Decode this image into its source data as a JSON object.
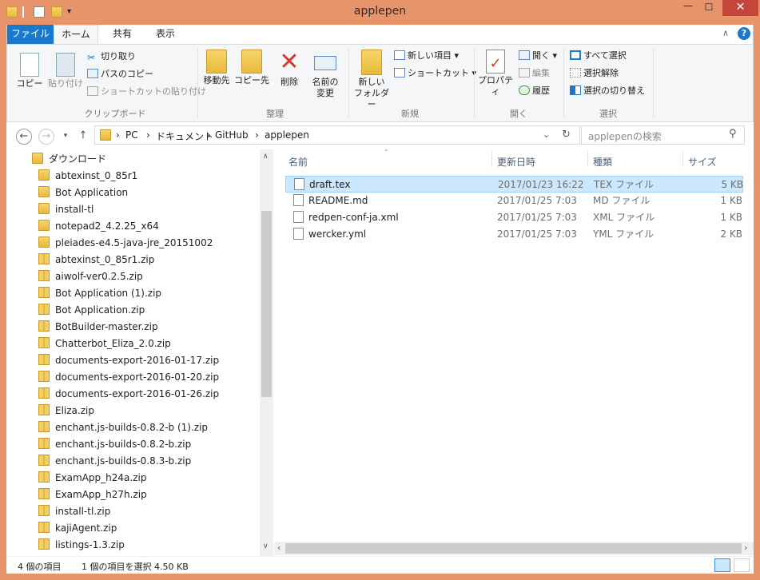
{
  "window": {
    "title": "applepen",
    "close_symbol": "✕",
    "minimize_symbol": "—",
    "maximize_symbol": "☐"
  },
  "ribbon_tabs": {
    "file": "ファイル",
    "home": "ホーム",
    "share": "共有",
    "view": "表示"
  },
  "ribbon": {
    "clipboard": {
      "copy": "コピー",
      "paste": "貼り付け",
      "cut": "切り取り",
      "copy_path": "パスのコピー",
      "paste_shortcut": "ショートカットの貼り付け",
      "label": "クリップボード"
    },
    "organize": {
      "move_to": "移動先",
      "copy_to": "コピー先",
      "delete": "削除",
      "rename_1": "名前の",
      "rename_2": "変更",
      "label": "整理"
    },
    "new": {
      "new_folder_1": "新しい",
      "new_folder_2": "フォルダー",
      "new_item": "新しい項目",
      "shortcut": "ショートカット",
      "label": "新規"
    },
    "open": {
      "properties": "プロパティ",
      "open": "開く",
      "edit": "編集",
      "history": "履歴",
      "label": "開く"
    },
    "select": {
      "select_all": "すべて選択",
      "select_none": "選択解除",
      "invert": "選択の切り替え",
      "label": "選択"
    }
  },
  "address": {
    "crumbs": [
      "PC",
      "ドキュメント",
      "GitHub",
      "applepen"
    ],
    "separator": "›",
    "search_placeholder": "applepenの検索"
  },
  "nav_tree": {
    "root": "ダウンロード",
    "items": [
      {
        "label": "abtexinst_0_85r1",
        "kind": "folder"
      },
      {
        "label": "Bot Application",
        "kind": "folder"
      },
      {
        "label": "install-tl",
        "kind": "folder"
      },
      {
        "label": "notepad2_4.2.25_x64",
        "kind": "folder"
      },
      {
        "label": "pleiades-e4.5-java-jre_20151002",
        "kind": "folder"
      },
      {
        "label": "abtexinst_0_85r1.zip",
        "kind": "zip"
      },
      {
        "label": "aiwolf-ver0.2.5.zip",
        "kind": "zip"
      },
      {
        "label": "Bot Application (1).zip",
        "kind": "zip"
      },
      {
        "label": "Bot Application.zip",
        "kind": "zip"
      },
      {
        "label": "BotBuilder-master.zip",
        "kind": "zip"
      },
      {
        "label": "Chatterbot_Eliza_2.0.zip",
        "kind": "zip"
      },
      {
        "label": "documents-export-2016-01-17.zip",
        "kind": "zip"
      },
      {
        "label": "documents-export-2016-01-20.zip",
        "kind": "zip"
      },
      {
        "label": "documents-export-2016-01-26.zip",
        "kind": "zip"
      },
      {
        "label": "Eliza.zip",
        "kind": "zip"
      },
      {
        "label": "enchant.js-builds-0.8.2-b (1).zip",
        "kind": "zip"
      },
      {
        "label": "enchant.js-builds-0.8.2-b.zip",
        "kind": "zip"
      },
      {
        "label": "enchant.js-builds-0.8.3-b.zip",
        "kind": "zip"
      },
      {
        "label": "ExamApp_h24a.zip",
        "kind": "zip"
      },
      {
        "label": "ExamApp_h27h.zip",
        "kind": "zip"
      },
      {
        "label": "install-tl.zip",
        "kind": "zip"
      },
      {
        "label": "kajiAgent.zip",
        "kind": "zip"
      },
      {
        "label": "listings-1.3.zip",
        "kind": "zip"
      }
    ]
  },
  "file_list": {
    "columns": {
      "name": "名前",
      "modified": "更新日時",
      "type": "種類",
      "size": "サイズ"
    },
    "rows": [
      {
        "name": "draft.tex",
        "modified": "2017/01/23 16:22",
        "type": "TEX ファイル",
        "size": "5 KB",
        "selected": true
      },
      {
        "name": "README.md",
        "modified": "2017/01/25 7:03",
        "type": "MD ファイル",
        "size": "1 KB",
        "selected": false
      },
      {
        "name": "redpen-conf-ja.xml",
        "modified": "2017/01/25 7:03",
        "type": "XML ファイル",
        "size": "1 KB",
        "selected": false
      },
      {
        "name": "wercker.yml",
        "modified": "2017/01/25 7:03",
        "type": "YML ファイル",
        "size": "2 KB",
        "selected": false
      }
    ]
  },
  "status": {
    "item_count": "4 個の項目",
    "selection": "1 個の項目を選択  4.50 KB"
  },
  "colors": {
    "title_bar": "#e8946a",
    "accent": "#1979ca",
    "selection": "#cce8ff",
    "close": "#c7463b"
  }
}
